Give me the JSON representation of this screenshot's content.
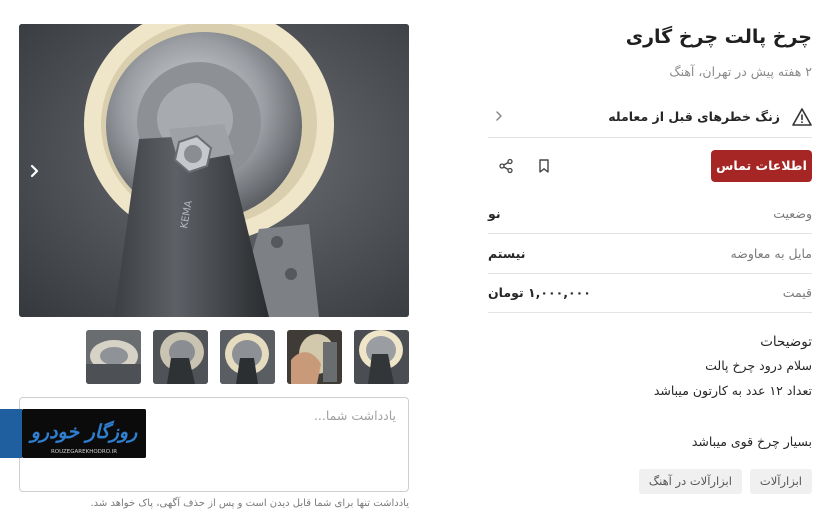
{
  "listing": {
    "title": "چرخ پالت چرخ گاری",
    "subtitle": "۲ هفته پیش در تهران، آهنگ"
  },
  "warning": {
    "text": "زنگ خطرهای قبل از معامله",
    "icon": "warning-triangle-icon"
  },
  "actions": {
    "contact_label": "اطلاعات تماس",
    "contact_color": "#a62626"
  },
  "attributes": [
    {
      "label": "وضعیت",
      "value": "نو"
    },
    {
      "label": "مایل به معاوضه",
      "value": "نیستم"
    },
    {
      "label": "قیمت",
      "value": "۱,۰۰۰,۰۰۰ تومان"
    }
  ],
  "description": {
    "title": "توضیحات",
    "lines": [
      "سلام درود چرخ پالت",
      "تعداد ۱۲ عدد به کارتون میباشد",
      "بسیار چرخ قوی میباشد"
    ]
  },
  "tags": [
    "ابزارآلات",
    "ابزارآلات در آهنگ"
  ],
  "note": {
    "placeholder": "یادداشت شما...",
    "hint": "یادداشت تنها برای شما قابل دیدن است و پس از حذف آگهی، پاک خواهد شد."
  },
  "gallery": {
    "thumbnail_count": 5
  },
  "watermark": {
    "text": "روزگار خودرو",
    "subtext": "ROUZEGAREKHODRO.IR"
  }
}
